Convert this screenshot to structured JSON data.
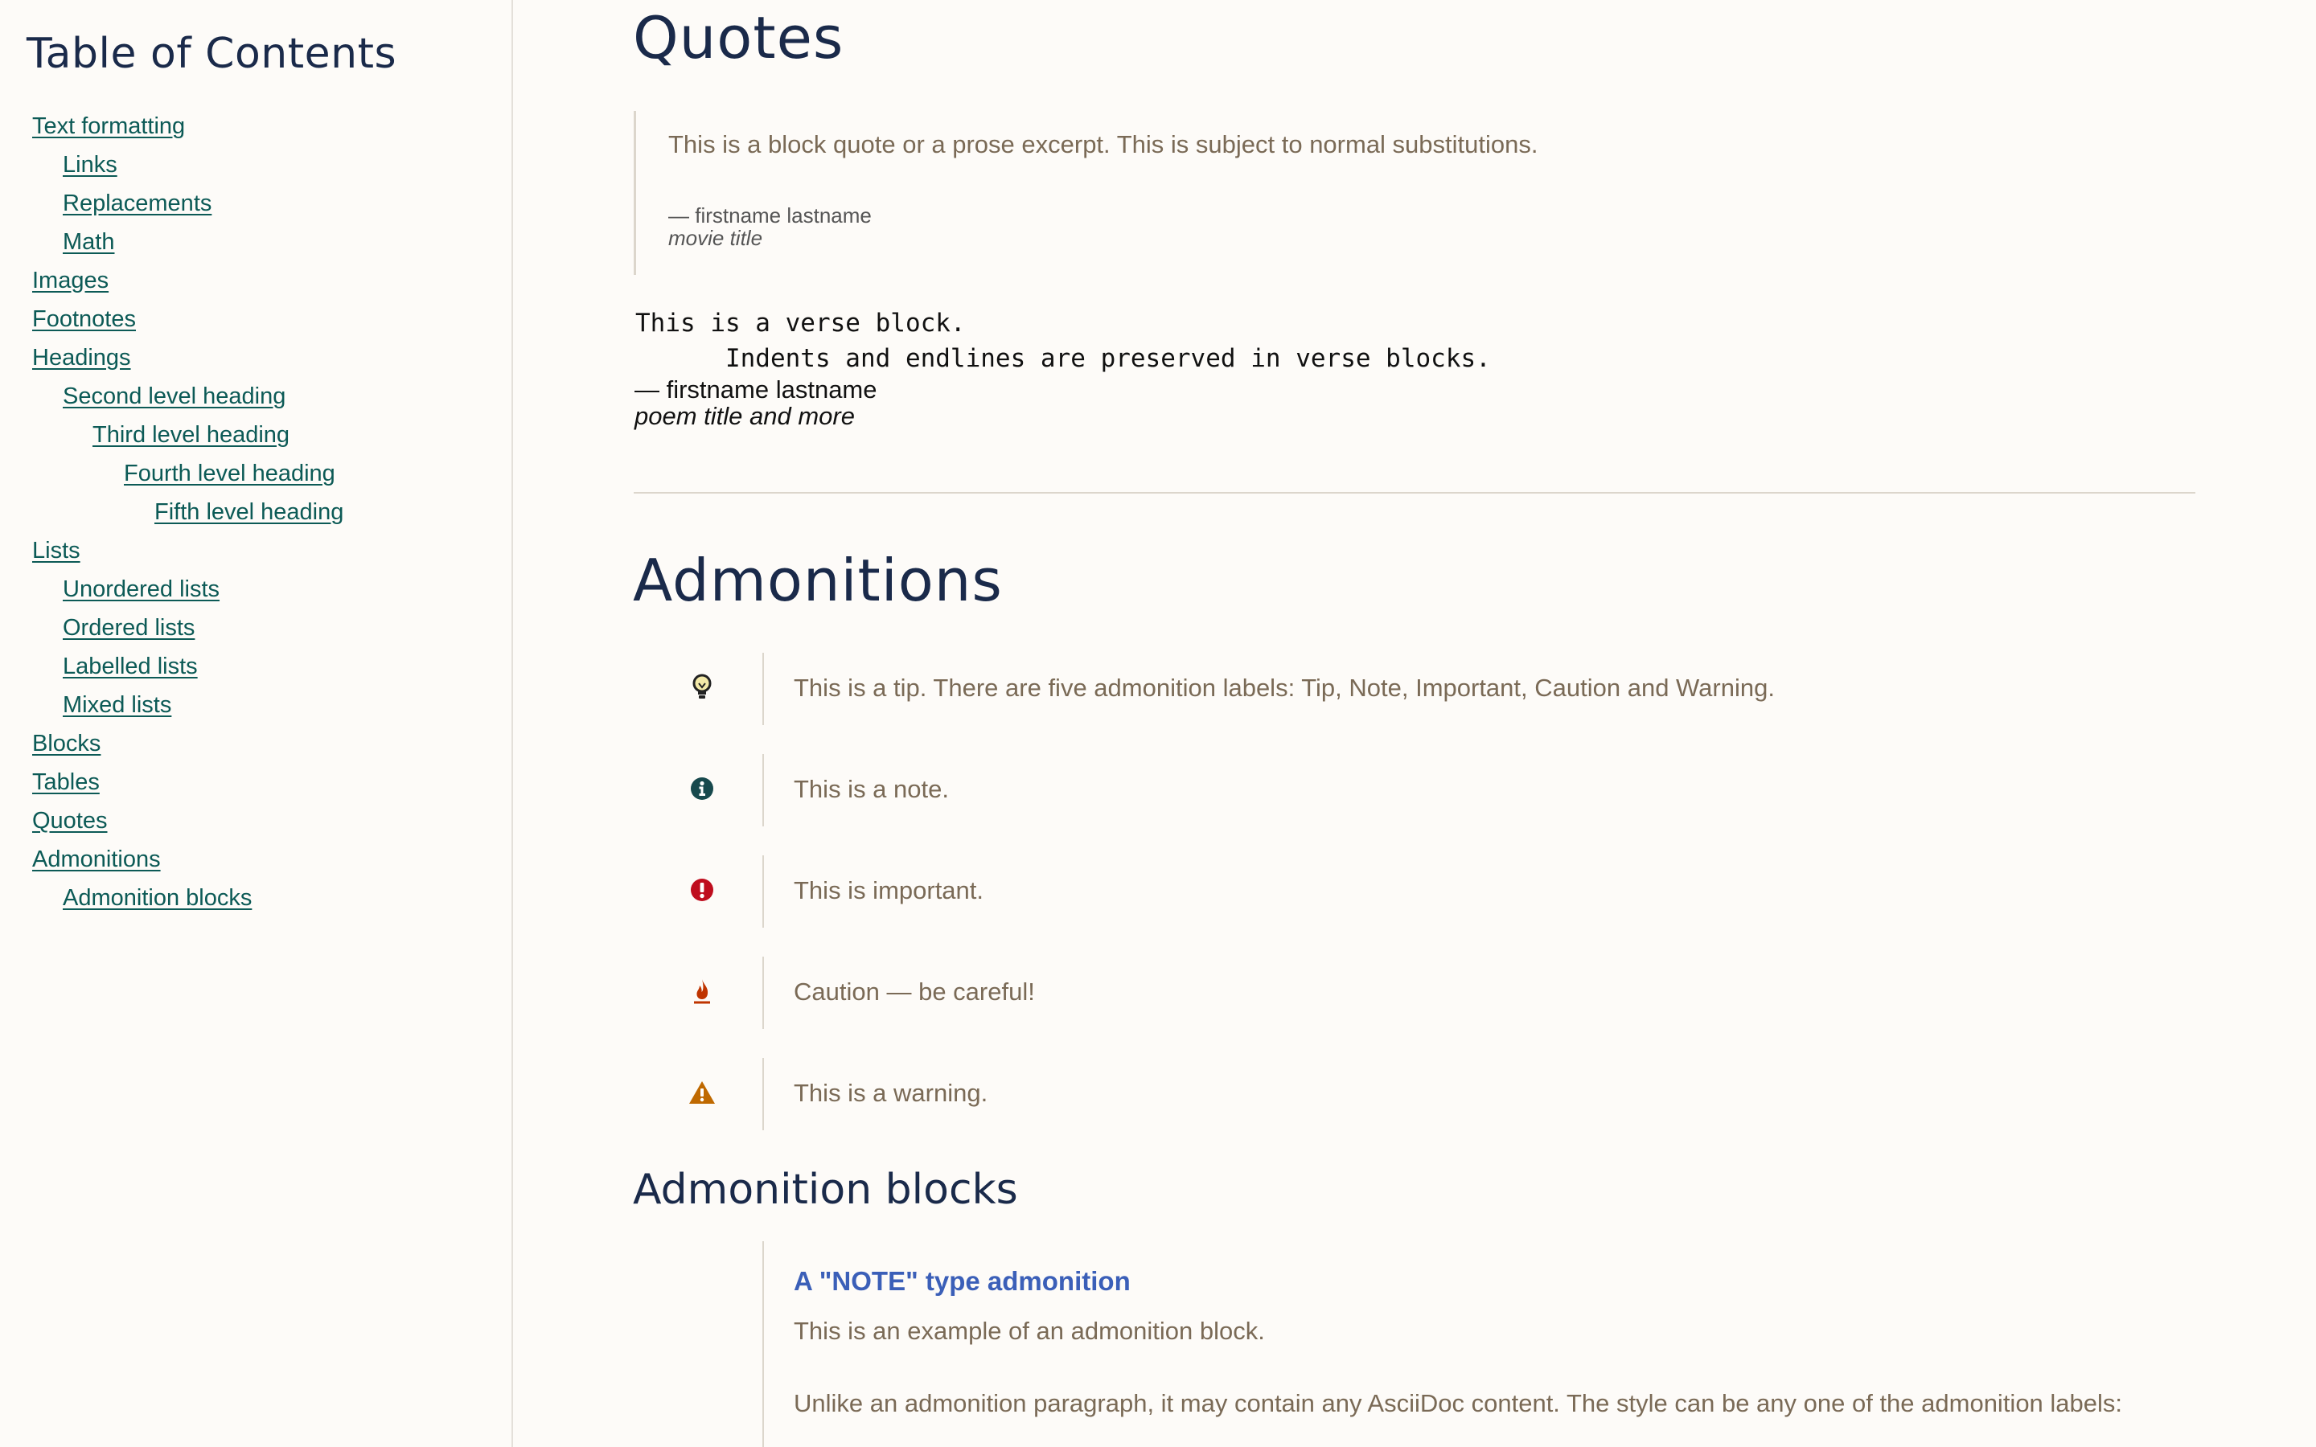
{
  "toc": {
    "title": "Table of Contents",
    "items": [
      {
        "label": "Text formatting",
        "level": 0
      },
      {
        "label": "Links",
        "level": 1
      },
      {
        "label": "Replacements",
        "level": 1
      },
      {
        "label": "Math",
        "level": 1
      },
      {
        "label": "Images",
        "level": 0
      },
      {
        "label": "Footnotes",
        "level": 0
      },
      {
        "label": "Headings",
        "level": 0
      },
      {
        "label": "Second level heading",
        "level": 1
      },
      {
        "label": "Third level heading",
        "level": 2
      },
      {
        "label": "Fourth level heading",
        "level": 3
      },
      {
        "label": "Fifth level heading",
        "level": 4
      },
      {
        "label": "Lists",
        "level": 0
      },
      {
        "label": "Unordered lists",
        "level": 1
      },
      {
        "label": "Ordered lists",
        "level": 1
      },
      {
        "label": "Labelled lists",
        "level": 1
      },
      {
        "label": "Mixed lists",
        "level": 1
      },
      {
        "label": "Blocks",
        "level": 0
      },
      {
        "label": "Tables",
        "level": 0
      },
      {
        "label": "Quotes",
        "level": 0
      },
      {
        "label": "Admonitions",
        "level": 0
      },
      {
        "label": "Admonition blocks",
        "level": 1
      }
    ]
  },
  "quotes": {
    "heading": "Quotes",
    "blockquote": {
      "text": "This is a block quote or a prose excerpt. This is subject to normal substitutions.",
      "attribution": "— firstname lastname",
      "citation": "movie title"
    },
    "verse": {
      "text": "This is a verse block.\n      Indents and endlines are preserved in verse blocks.",
      "attribution": "— firstname lastname",
      "citation": "poem title and more"
    }
  },
  "admonitions": {
    "heading": "Admonitions",
    "items": [
      {
        "type": "tip",
        "icon": "lightbulb-icon",
        "color": "#2a2a2a",
        "text": "This is a tip. There are five admonition labels: Tip, Note, Important, Caution and Warning."
      },
      {
        "type": "note",
        "icon": "info-icon",
        "color": "#17494d",
        "text": "This is a note."
      },
      {
        "type": "important",
        "icon": "exclamation-circle-icon",
        "color": "#bf0d1e",
        "text": "This is important."
      },
      {
        "type": "caution",
        "icon": "fire-icon",
        "color": "#bf3400",
        "text": "Caution — be careful!"
      },
      {
        "type": "warning",
        "icon": "warning-triangle-icon",
        "color": "#bf6900",
        "text": "This is a warning."
      }
    ]
  },
  "admonition_blocks": {
    "heading": "Admonition blocks",
    "title": "A \"NOTE\" type admonition",
    "paragraph1": "This is an example of an admonition block.",
    "paragraph2": "Unlike an admonition paragraph, it may contain any AsciiDoc content. The style can be any one of the admonition labels:"
  }
}
